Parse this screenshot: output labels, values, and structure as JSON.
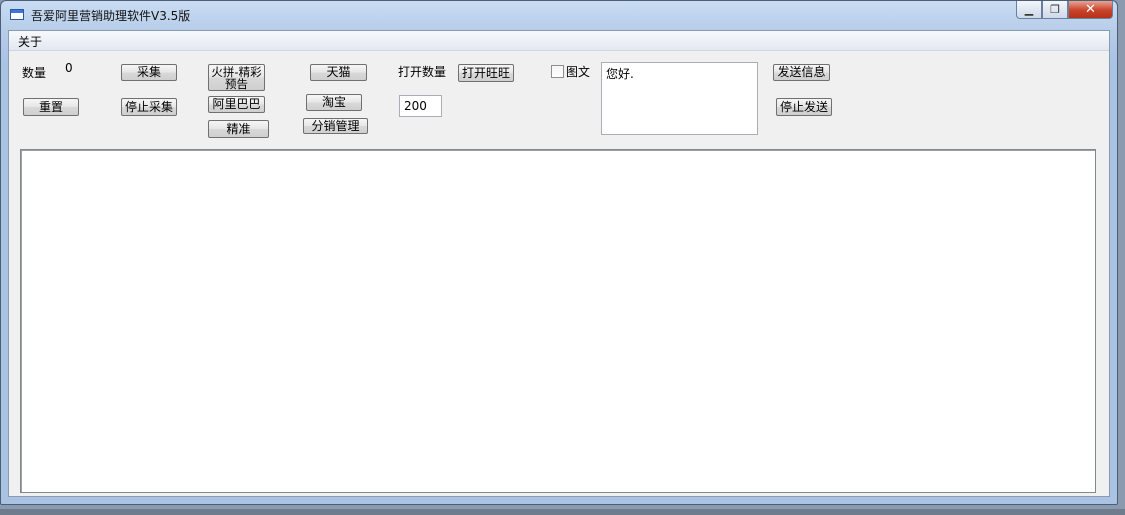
{
  "window": {
    "title": "吾爱阿里营销助理软件V3.5版"
  },
  "menu": {
    "about": "关于"
  },
  "controls": {
    "count_label": "数量",
    "count_value": "0",
    "collect": "采集",
    "reset": "重置",
    "stop_collect": "停止采集",
    "huopin_line1": "火拼-精彩",
    "huopin_line2": "预告",
    "alibaba": "阿里巴巴",
    "precise": "精准",
    "tmall": "天猫",
    "taobao": "淘宝",
    "distribution": "分销管理",
    "open_count_label": "打开数量",
    "open_wangwang": "打开旺旺",
    "open_count_value": "200",
    "image_text_label": "图文",
    "image_text_checked": false,
    "message_text": "您好.",
    "send_message": "发送信息",
    "stop_send": "停止发送"
  },
  "output": {
    "text": ""
  }
}
